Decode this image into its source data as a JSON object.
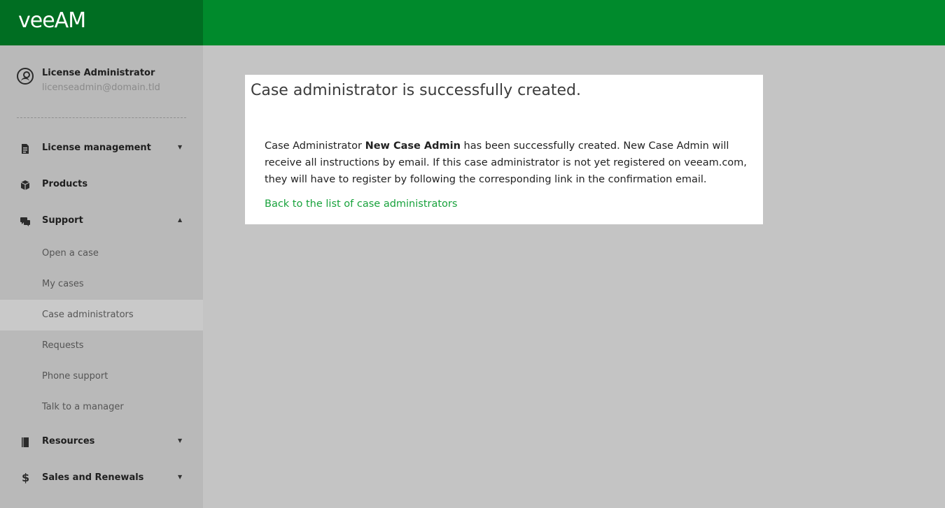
{
  "header": {
    "logo_text": "veeAM",
    "brand_color": "#008a2c",
    "brand_dark": "#006e22"
  },
  "user": {
    "name": "License Administrator",
    "email": "licenseadmin@domain.tld"
  },
  "sidebar": {
    "items": [
      {
        "label": "License management",
        "icon": "document-icon",
        "expanded": false
      },
      {
        "label": "Products",
        "icon": "box-icon"
      },
      {
        "label": "Support",
        "icon": "chat-icon",
        "expanded": true
      },
      {
        "label": "Resources",
        "icon": "book-icon",
        "expanded": false
      },
      {
        "label": "Sales and Renewals",
        "icon": "dollar-icon",
        "expanded": false
      }
    ],
    "support_subitems": [
      {
        "label": "Open a case"
      },
      {
        "label": "My cases"
      },
      {
        "label": "Case administrators",
        "active": true
      },
      {
        "label": "Requests"
      },
      {
        "label": "Phone support"
      },
      {
        "label": "Talk to a manager"
      }
    ]
  },
  "main": {
    "title": "Case administrator is successfully created.",
    "body_prefix": "Case Administrator ",
    "admin_name": "New Case Admin",
    "body_suffix": " has been successfully created. New Case Admin will receive all instructions by email. If this case administrator is not yet registered on veeam.com, they will have to register by following the corresponding link in the confirmation email.",
    "back_link": "Back to the list of case administrators",
    "link_color": "#18a23c"
  }
}
